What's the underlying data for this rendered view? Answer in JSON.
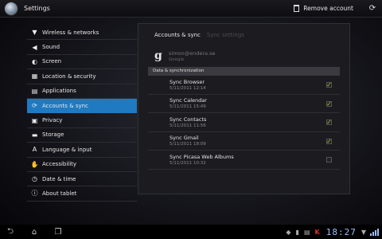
{
  "actionbar": {
    "title": "Settings",
    "remove_account_label": "Remove account"
  },
  "left_menu": {
    "selected_index": 5,
    "items": [
      {
        "label": "Wireless & networks",
        "icon": "wifi-icon",
        "glyph": "▼"
      },
      {
        "label": "Sound",
        "icon": "speaker-icon",
        "glyph": "◀"
      },
      {
        "label": "Screen",
        "icon": "brightness-icon",
        "glyph": "◐"
      },
      {
        "label": "Location & security",
        "icon": "grid-icon",
        "glyph": "▦"
      },
      {
        "label": "Applications",
        "icon": "apps-icon",
        "glyph": "▤"
      },
      {
        "label": "Accounts & sync",
        "icon": "sync-icon",
        "glyph": "⟳"
      },
      {
        "label": "Privacy",
        "icon": "lock-icon",
        "glyph": "▣"
      },
      {
        "label": "Storage",
        "icon": "storage-icon",
        "glyph": "▬"
      },
      {
        "label": "Language & input",
        "icon": "language-icon",
        "glyph": "A"
      },
      {
        "label": "Accessibility",
        "icon": "hand-icon",
        "glyph": "✋"
      },
      {
        "label": "Date & time",
        "icon": "clock-icon",
        "glyph": "◷"
      },
      {
        "label": "About tablet",
        "icon": "info-icon",
        "glyph": "ⓘ"
      }
    ]
  },
  "panel": {
    "tabs": [
      {
        "label": "Accounts & sync",
        "active": true
      },
      {
        "label": "Sync settings",
        "active": false
      }
    ],
    "account": {
      "email": "simon@endera.se",
      "type": "Google",
      "icon": "google-g-icon"
    },
    "section_header": "Data & synchronization",
    "sync_items": [
      {
        "name": "Sync Browser",
        "date": "5/11/2011 12:14",
        "checked": true
      },
      {
        "name": "Sync Calendar",
        "date": "5/11/2011 15:49",
        "checked": true
      },
      {
        "name": "Sync Contacts",
        "date": "5/11/2011 11:56",
        "checked": true
      },
      {
        "name": "Sync Gmail",
        "date": "5/11/2011 18:09",
        "checked": true
      },
      {
        "name": "Sync Picasa Web Albums",
        "date": "5/11/2011 10:32",
        "checked": false
      }
    ],
    "check_color": "#a8d020"
  },
  "systembar": {
    "clock": "18:27",
    "accent": "#9ac0ff"
  }
}
